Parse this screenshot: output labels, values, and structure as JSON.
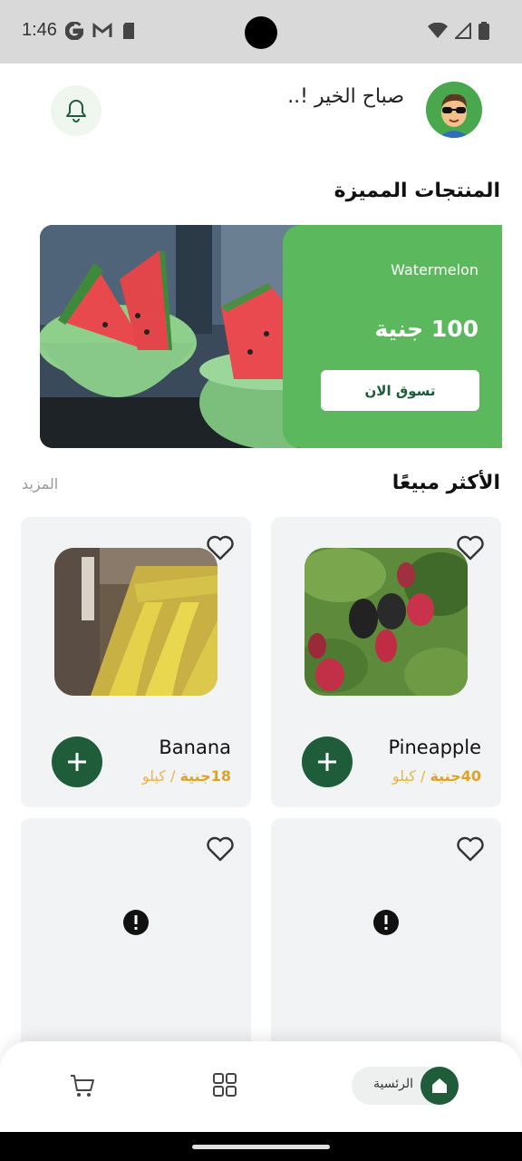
{
  "status_bar": {
    "time": "1:46"
  },
  "header": {
    "greeting": "صباح الخير !.."
  },
  "featured": {
    "title": "المنتجات المميزة",
    "banner": {
      "product_name": "Watermelon",
      "price": "100 جنية",
      "cta_label": "تسوق الان"
    }
  },
  "best_sellers": {
    "title": "الأكثر مبيعًا",
    "more_label": "المزيد",
    "items": [
      {
        "name": "Pineapple",
        "price": "40جنية",
        "unit": "/ كيلو"
      },
      {
        "name": "Banana",
        "price": "18جنية",
        "unit": "/ كيلو"
      }
    ]
  },
  "bottom_nav": {
    "home_label": "الرئسية"
  },
  "colors": {
    "primary_green": "#1f5c3a",
    "banner_green": "#5cb85c",
    "price_orange": "#e0a226"
  }
}
